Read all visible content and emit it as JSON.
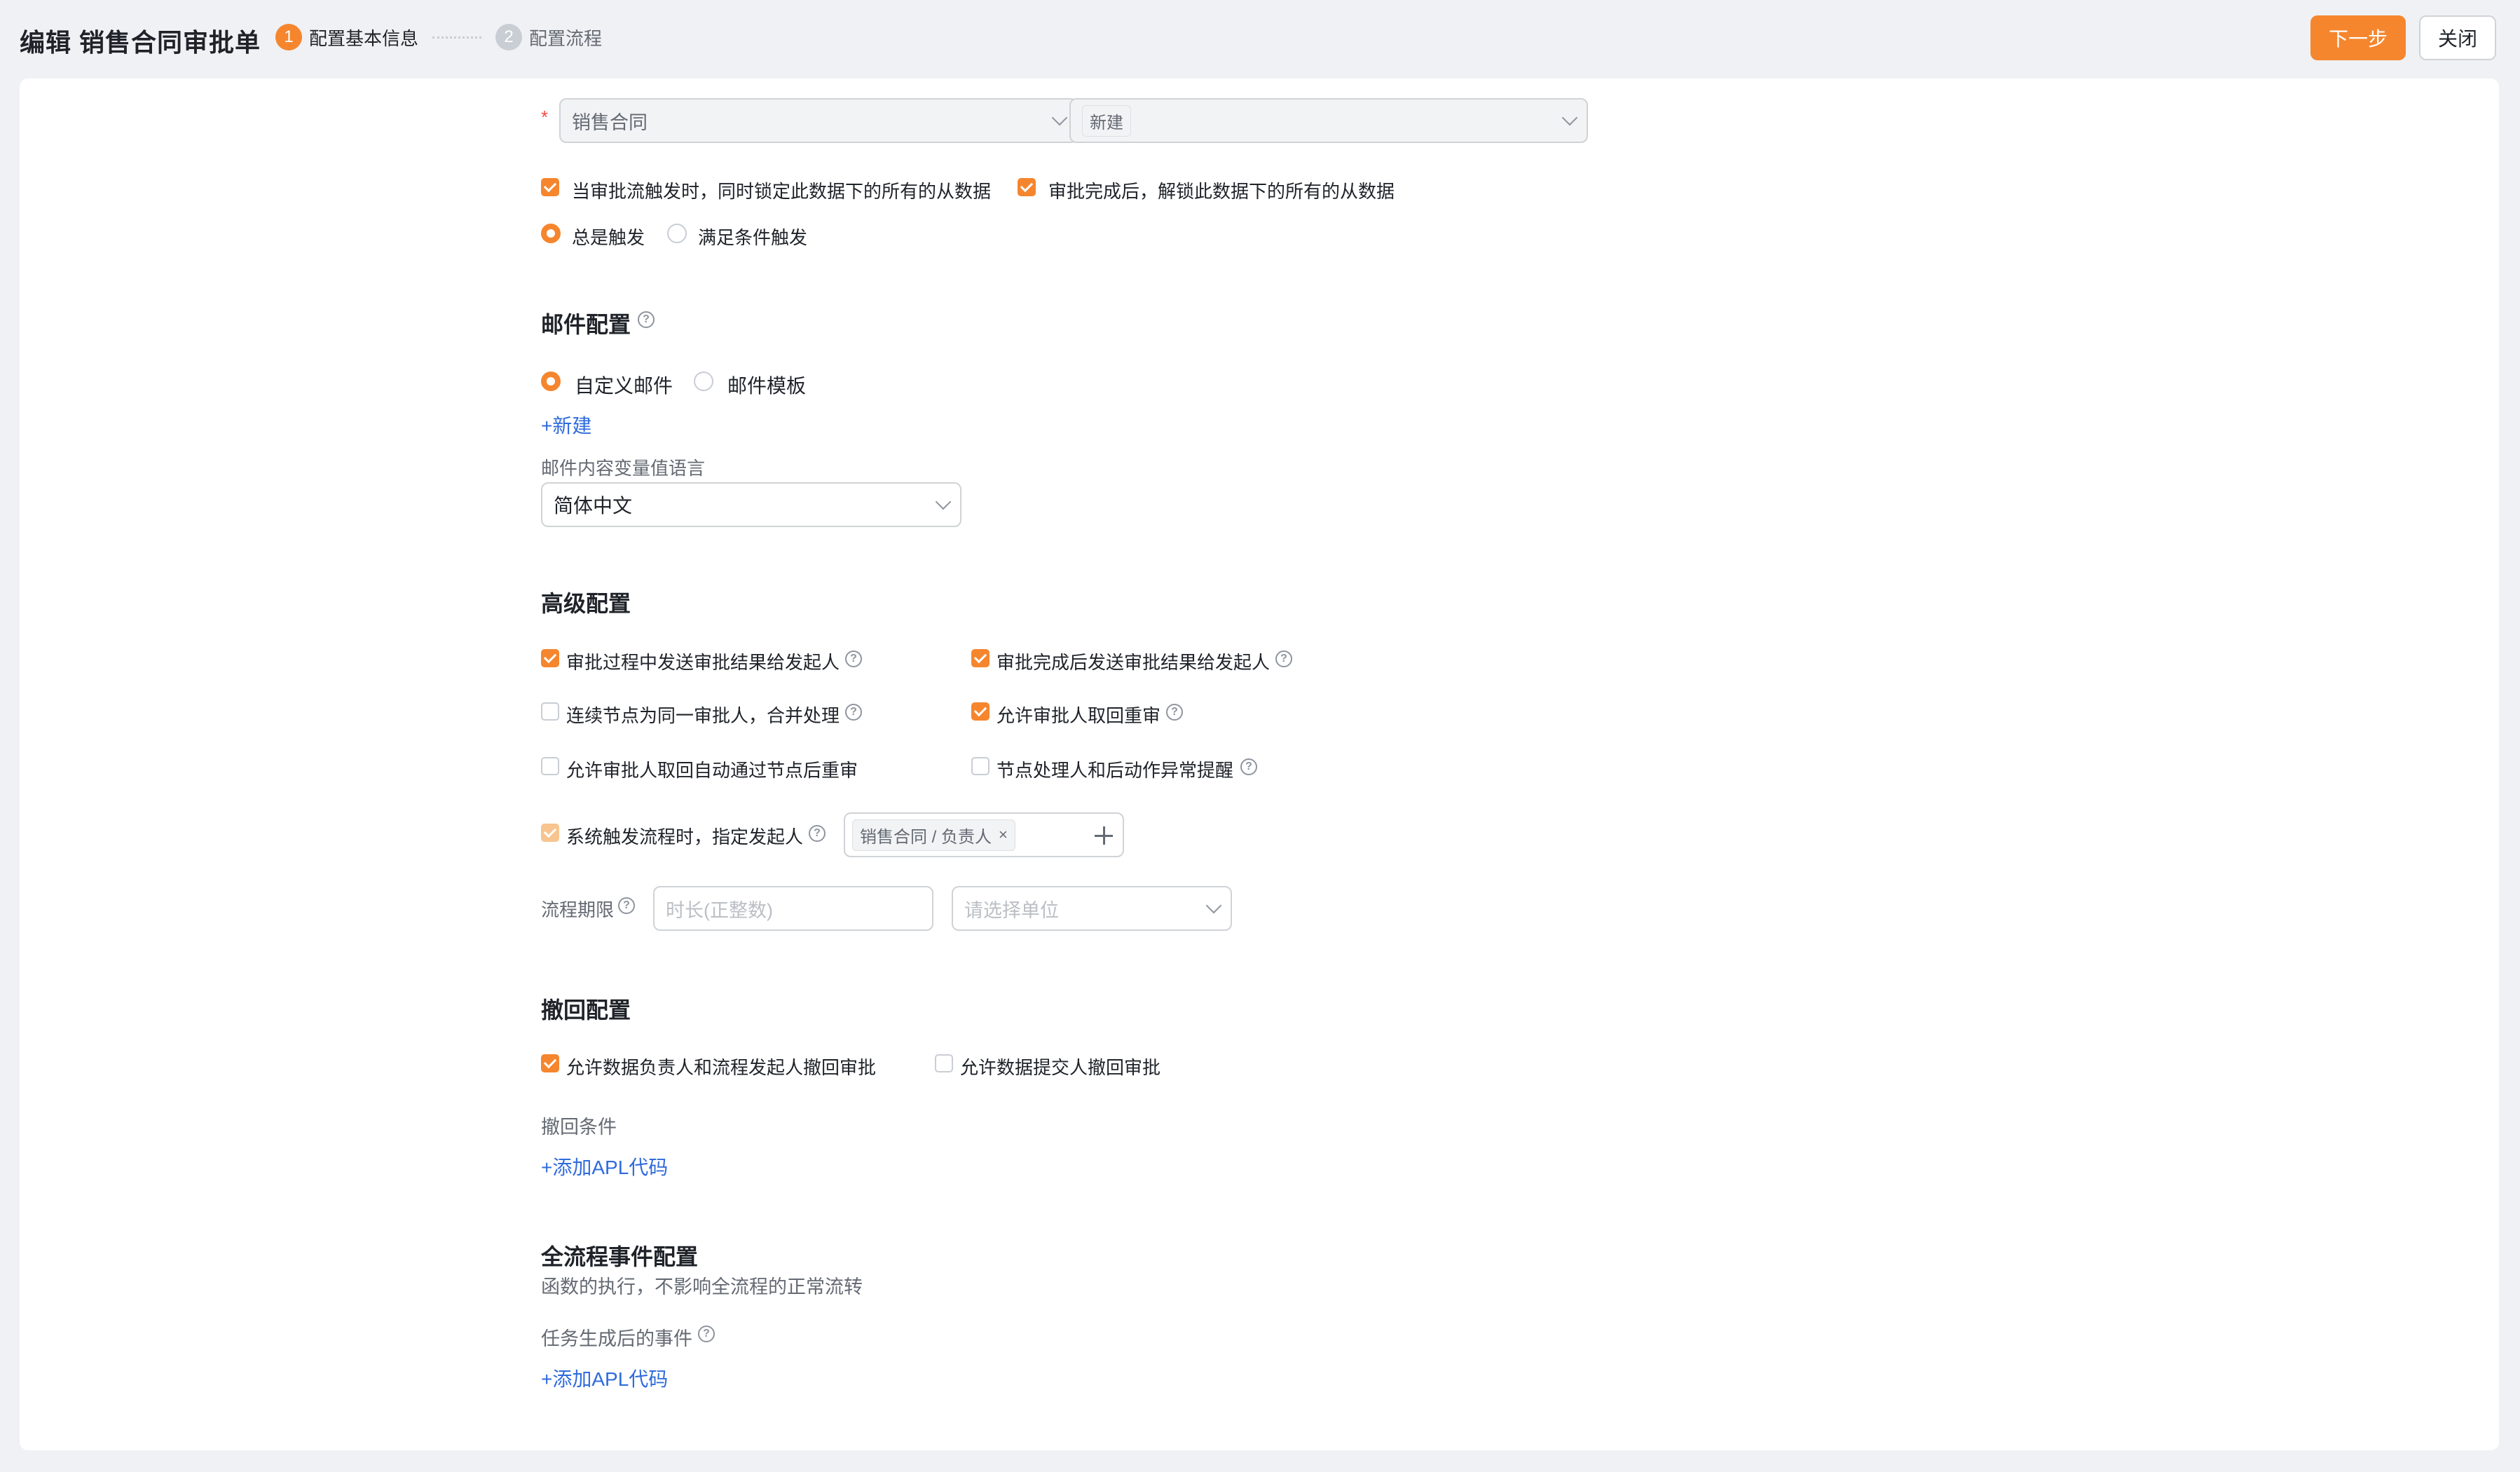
{
  "header": {
    "title": "编辑 销售合同审批单",
    "steps": [
      {
        "num": "1",
        "label": "配置基本信息"
      },
      {
        "num": "2",
        "label": "配置流程"
      }
    ],
    "next_button": "下一步",
    "close_button": "关闭"
  },
  "trigger": {
    "required_mark": "*",
    "object_select": "销售合同",
    "action_tag": "新建",
    "lock_option": "当审批流触发时，同时锁定此数据下的所有的从数据",
    "unlock_option": "审批完成后，解锁此数据下的所有的从数据",
    "radio_always": "总是触发",
    "radio_conditional": "满足条件触发"
  },
  "mail": {
    "title": "邮件配置",
    "radio_custom": "自定义邮件",
    "radio_template": "邮件模板",
    "new_link": "+新建",
    "lang_label": "邮件内容变量值语言",
    "lang_value": "简体中文"
  },
  "advanced": {
    "title": "高级配置",
    "options": {
      "send_during": "审批过程中发送审批结果给发起人",
      "send_after": "审批完成后发送审批结果给发起人",
      "merge_same": "连续节点为同一审批人，合并处理",
      "allow_recall_re": "允许审批人取回重审",
      "allow_recall_auto": "允许审批人取回自动通过节点后重审",
      "node_alert": "节点处理人和后动作异常提醒",
      "system_trigger": "系统触发流程时，指定发起人"
    },
    "initiator_tag": "销售合同 / 负责人",
    "tag_close": "×",
    "deadline_label": "流程期限",
    "duration_placeholder": "时长(正整数)",
    "unit_placeholder": "请选择单位"
  },
  "revoke": {
    "title": "撤回配置",
    "allow_owner": "允许数据负责人和流程发起人撤回审批",
    "allow_submitter": "允许数据提交人撤回审批",
    "condition_label": "撤回条件",
    "add_apl": "+添加APL代码"
  },
  "events": {
    "title": "全流程事件配置",
    "subtitle": "函数的执行，不影响全流程的正常流转",
    "task_label": "任务生成后的事件",
    "add_apl": "+添加APL代码"
  },
  "icons": {
    "help": "?"
  },
  "colors": {
    "accent": "#f5862e",
    "link": "#2f6bdc",
    "background": "#f0f1f4"
  }
}
